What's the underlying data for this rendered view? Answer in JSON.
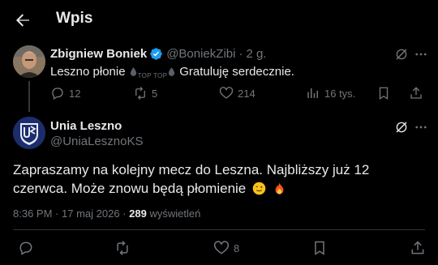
{
  "header": {
    "title": "Wpis"
  },
  "quoted": {
    "name": "Zbigniew Boniek",
    "handle": "@BoniekZibi",
    "separator": "·",
    "time": "2 g.",
    "text_before": "Leszno płonie",
    "badge_text": "TOP TOP",
    "text_after": "Gratuluję serdecznie.",
    "stats": {
      "replies": "12",
      "reposts": "5",
      "likes": "214",
      "views": "16 tys."
    }
  },
  "main": {
    "name": "Unia Leszno",
    "handle": "@UniaLesznoKS",
    "text": "Zapraszamy na kolejny mecz do Leszna. Najbliższy już 12 czerwca. Może znowu będą płomienie",
    "emojis": [
      "winking-face",
      "fire"
    ],
    "meta": {
      "time": "8:36 PM",
      "separator": "·",
      "date": "17 maj 2026",
      "views_count": "289",
      "views_label": "wyświetleń"
    },
    "stats": {
      "likes": "8"
    }
  },
  "colors": {
    "background": "#000000",
    "text": "#e7e9ea",
    "muted": "#71767b",
    "verified": "#1d9bf0",
    "divider": "#2f3336"
  },
  "icons": [
    "back-arrow-icon",
    "verified-badge-icon",
    "grok-icon",
    "more-icon",
    "reply-icon",
    "repost-icon",
    "like-icon",
    "views-icon",
    "bookmark-icon",
    "share-icon"
  ]
}
